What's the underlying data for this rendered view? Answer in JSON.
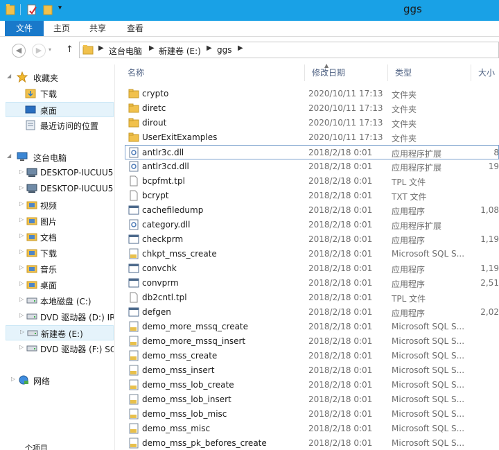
{
  "window": {
    "title": "ggs"
  },
  "ribbon": {
    "tabs": [
      {
        "label": "文件",
        "active": true
      },
      {
        "label": "主页",
        "active": false
      },
      {
        "label": "共享",
        "active": false
      },
      {
        "label": "查看",
        "active": false
      }
    ]
  },
  "address": {
    "crumbs": [
      "这台电脑",
      "新建卷 (E:)",
      "ggs"
    ]
  },
  "sidebar": {
    "favorites": {
      "label": "收藏夹",
      "items": [
        "下载",
        "桌面",
        "最近访问的位置"
      ]
    },
    "pc": {
      "label": "这台电脑",
      "items": [
        "DESKTOP-IUCUU5",
        "DESKTOP-IUCUU5",
        "视频",
        "图片",
        "文档",
        "下载",
        "音乐",
        "桌面",
        "本地磁盘 (C:)",
        "DVD 驱动器 (D:) IR",
        "新建卷 (E:)",
        "DVD 驱动器 (F:) SQ"
      ]
    },
    "network": {
      "label": "网络"
    },
    "bottom_label": "个项目"
  },
  "columns": {
    "name": "名称",
    "date": "修改日期",
    "type": "类型",
    "size": "大小"
  },
  "files": [
    {
      "name": "crypto",
      "date": "2020/10/11 17:13",
      "type": "文件夹",
      "size": "",
      "icon": "folder-icon"
    },
    {
      "name": "diretc",
      "date": "2020/10/11 17:13",
      "type": "文件夹",
      "size": "",
      "icon": "folder-icon"
    },
    {
      "name": "dirout",
      "date": "2020/10/11 17:13",
      "type": "文件夹",
      "size": "",
      "icon": "folder-icon"
    },
    {
      "name": "UserExitExamples",
      "date": "2020/10/11 17:13",
      "type": "文件夹",
      "size": "",
      "icon": "folder-icon"
    },
    {
      "name": "antlr3c.dll",
      "date": "2018/2/18 0:01",
      "type": "应用程序扩展",
      "size": "8",
      "icon": "dll-icon"
    },
    {
      "name": "antlr3cd.dll",
      "date": "2018/2/18 0:01",
      "type": "应用程序扩展",
      "size": "19",
      "icon": "dll-icon"
    },
    {
      "name": "bcpfmt.tpl",
      "date": "2018/2/18 0:01",
      "type": "TPL 文件",
      "size": "",
      "icon": "file-icon"
    },
    {
      "name": "bcrypt",
      "date": "2018/2/18 0:01",
      "type": "TXT 文件",
      "size": "",
      "icon": "file-icon"
    },
    {
      "name": "cachefiledump",
      "date": "2018/2/18 0:01",
      "type": "应用程序",
      "size": "1,08",
      "icon": "exe-icon"
    },
    {
      "name": "category.dll",
      "date": "2018/2/18 0:01",
      "type": "应用程序扩展",
      "size": "",
      "icon": "dll-icon"
    },
    {
      "name": "checkprm",
      "date": "2018/2/18 0:01",
      "type": "应用程序",
      "size": "1,19",
      "icon": "exe-icon"
    },
    {
      "name": "chkpt_mss_create",
      "date": "2018/2/18 0:01",
      "type": "Microsoft SQL S...",
      "size": "",
      "icon": "sql-icon"
    },
    {
      "name": "convchk",
      "date": "2018/2/18 0:01",
      "type": "应用程序",
      "size": "1,19",
      "icon": "exe-icon"
    },
    {
      "name": "convprm",
      "date": "2018/2/18 0:01",
      "type": "应用程序",
      "size": "2,51",
      "icon": "exe-icon"
    },
    {
      "name": "db2cntl.tpl",
      "date": "2018/2/18 0:01",
      "type": "TPL 文件",
      "size": "",
      "icon": "file-icon"
    },
    {
      "name": "defgen",
      "date": "2018/2/18 0:01",
      "type": "应用程序",
      "size": "2,02",
      "icon": "exe-icon"
    },
    {
      "name": "demo_more_mssq_create",
      "date": "2018/2/18 0:01",
      "type": "Microsoft SQL S...",
      "size": "",
      "icon": "sql-icon"
    },
    {
      "name": "demo_more_mssq_insert",
      "date": "2018/2/18 0:01",
      "type": "Microsoft SQL S...",
      "size": "",
      "icon": "sql-icon"
    },
    {
      "name": "demo_mss_create",
      "date": "2018/2/18 0:01",
      "type": "Microsoft SQL S...",
      "size": "",
      "icon": "sql-icon"
    },
    {
      "name": "demo_mss_insert",
      "date": "2018/2/18 0:01",
      "type": "Microsoft SQL S...",
      "size": "",
      "icon": "sql-icon"
    },
    {
      "name": "demo_mss_lob_create",
      "date": "2018/2/18 0:01",
      "type": "Microsoft SQL S...",
      "size": "",
      "icon": "sql-icon"
    },
    {
      "name": "demo_mss_lob_insert",
      "date": "2018/2/18 0:01",
      "type": "Microsoft SQL S...",
      "size": "",
      "icon": "sql-icon"
    },
    {
      "name": "demo_mss_lob_misc",
      "date": "2018/2/18 0:01",
      "type": "Microsoft SQL S...",
      "size": "",
      "icon": "sql-icon"
    },
    {
      "name": "demo_mss_misc",
      "date": "2018/2/18 0:01",
      "type": "Microsoft SQL S...",
      "size": "",
      "icon": "sql-icon"
    },
    {
      "name": "demo_mss_pk_befores_create",
      "date": "2018/2/18 0:01",
      "type": "Microsoft SQL S...",
      "size": "",
      "icon": "sql-icon"
    }
  ],
  "selected_file": "antlr3c.dll",
  "colors": {
    "titlebar": "#19a1e6",
    "file_tab": "#1979ca",
    "selection": "#e5f3fb",
    "folder": "#f1c14c"
  }
}
